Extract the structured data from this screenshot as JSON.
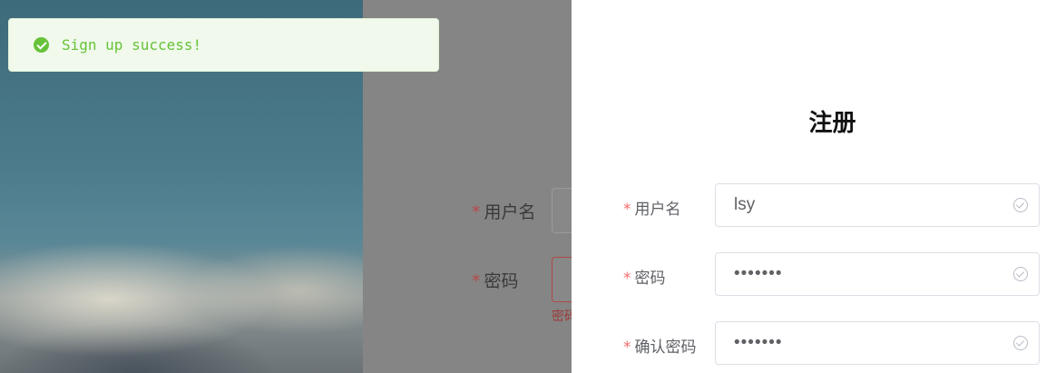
{
  "toast": {
    "message": "Sign up success!",
    "icon": "check-circle-icon",
    "color": "#67c23a"
  },
  "background_form": {
    "fields": [
      {
        "label": "用户名"
      },
      {
        "label": "密码"
      }
    ],
    "error_text": "密码"
  },
  "drawer": {
    "title": "注册",
    "fields": [
      {
        "label": "用户名",
        "value": "lsy",
        "type": "text"
      },
      {
        "label": "密码",
        "value": "1234567",
        "type": "password"
      },
      {
        "label": "确认密码",
        "value": "1234567",
        "type": "password"
      }
    ],
    "required_mark": "*"
  },
  "colors": {
    "accent_success": "#67c23a",
    "required": "#f56c6c",
    "overlay": "#858585"
  }
}
